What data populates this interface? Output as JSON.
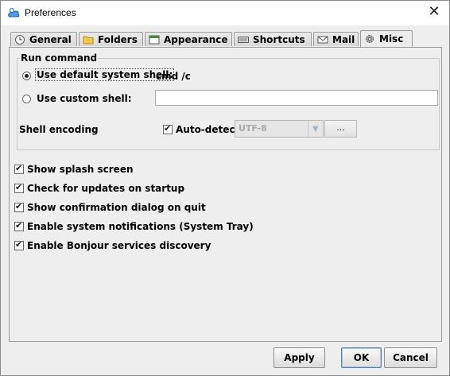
{
  "window": {
    "title": "Preferences",
    "close_glyph": "✕"
  },
  "tabs": [
    {
      "label": "General",
      "icon": "clock-icon"
    },
    {
      "label": "Folders",
      "icon": "folder-icon"
    },
    {
      "label": "Appearance",
      "icon": "window-icon"
    },
    {
      "label": "Shortcuts",
      "icon": "keyboard-icon"
    },
    {
      "label": "Mail",
      "icon": "envelope-icon"
    },
    {
      "label": "Misc",
      "icon": "gear-icon",
      "active": true
    }
  ],
  "run_command": {
    "legend": "Run command",
    "default_shell_label": "Use default system shell:",
    "default_shell_value": "cmd /c",
    "custom_shell_label": "Use custom shell:",
    "custom_shell_value": "",
    "selected": "default",
    "encoding_label": "Shell encoding",
    "auto_detect_label": "Auto-detect",
    "auto_detect_checked": true,
    "encoding_value": "UTF-8",
    "browse_label": "..."
  },
  "options": [
    {
      "label": "Show splash screen",
      "checked": true
    },
    {
      "label": "Check for updates on startup",
      "checked": true
    },
    {
      "label": "Show confirmation dialog on quit",
      "checked": true
    },
    {
      "label": "Enable system notifications (System Tray)",
      "checked": true
    },
    {
      "label": "Enable Bonjour services discovery",
      "checked": true
    }
  ],
  "buttons": {
    "apply": "Apply",
    "ok": "OK",
    "cancel": "Cancel"
  },
  "colors": {
    "accent": "#5a7fb8",
    "window_bg": "#eeeeee",
    "disabled_text": "#a8a8a8"
  }
}
